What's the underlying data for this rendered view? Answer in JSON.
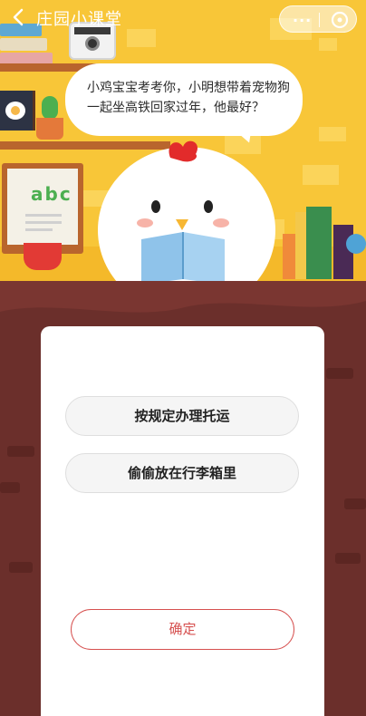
{
  "header": {
    "title": "庄园小课堂",
    "more_label": "···"
  },
  "question": {
    "text": "小鸡宝宝考考你，小明想带着宠物狗一起坐高铁回家过年，他最好？"
  },
  "board": {
    "letters": "abc"
  },
  "options": [
    {
      "label": "按规定办理托运"
    },
    {
      "label": "偷偷放在行李箱里"
    }
  ],
  "confirm": {
    "label": "确定"
  },
  "colors": {
    "scene_bg": "#f8c638",
    "bottom_bg": "#6b2f2b",
    "accent": "#d6504f"
  }
}
